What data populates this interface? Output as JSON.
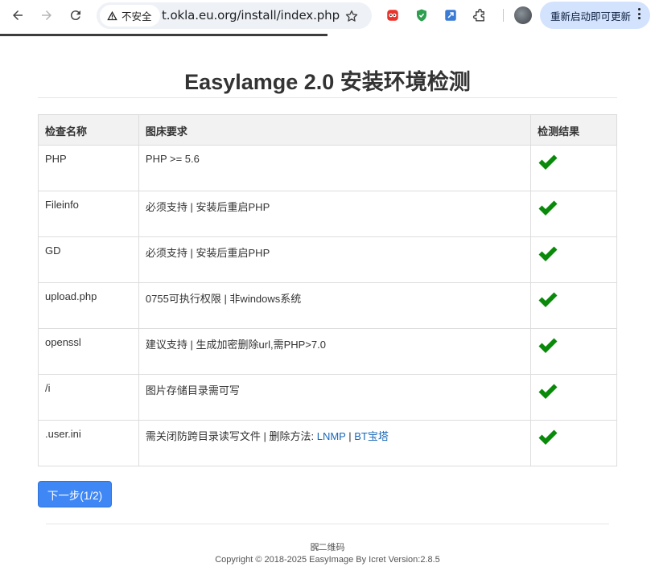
{
  "browser": {
    "security_label": "不安全",
    "url": "t.okla.eu.org/install/index.php",
    "update_button_label": "重新启动即可更新",
    "extensions": [
      "red-extension-icon",
      "shield-extension-icon",
      "screenshot-extension-icon",
      "puzzle-extensions-icon"
    ]
  },
  "page": {
    "title": "Easylamge 2.0 安装环境检测",
    "table": {
      "headers": [
        "检查名称",
        "图床要求",
        "检测结果"
      ],
      "rows": [
        {
          "name": "PHP",
          "requirement": "PHP >= 5.6",
          "result": "pass"
        },
        {
          "name": "Fileinfo",
          "requirement": "必须支持 | 安装后重启PHP",
          "result": "pass"
        },
        {
          "name": "GD",
          "requirement": "必须支持 | 安装后重启PHP",
          "result": "pass"
        },
        {
          "name": "upload.php",
          "requirement": "0755可执行权限 | 非windows系统",
          "result": "pass"
        },
        {
          "name": "openssl",
          "requirement": "建议支持 | 生成加密删除url,需PHP>7.0",
          "result": "pass"
        },
        {
          "name": "/i",
          "requirement": "图片存储目录需可写",
          "result": "pass"
        },
        {
          "name": ".user.ini",
          "requirement": "需关闭防跨目录读写文件 | 删除方法: ",
          "links": [
            "LNMP",
            "BT宝塔"
          ],
          "link_separator": " | ",
          "result": "pass"
        }
      ]
    },
    "next_button_label": "下一步(1/2)",
    "footer": {
      "qr_label": "二维码",
      "copyright": "Copyright © 2018-2025 EasyImage By Icret Version:2.8.5"
    }
  },
  "colors": {
    "check_green": "#0a8a0a",
    "primary_button": "#3f87f5",
    "link": "#1a68b7",
    "update_chip": "#d3e3fd"
  }
}
